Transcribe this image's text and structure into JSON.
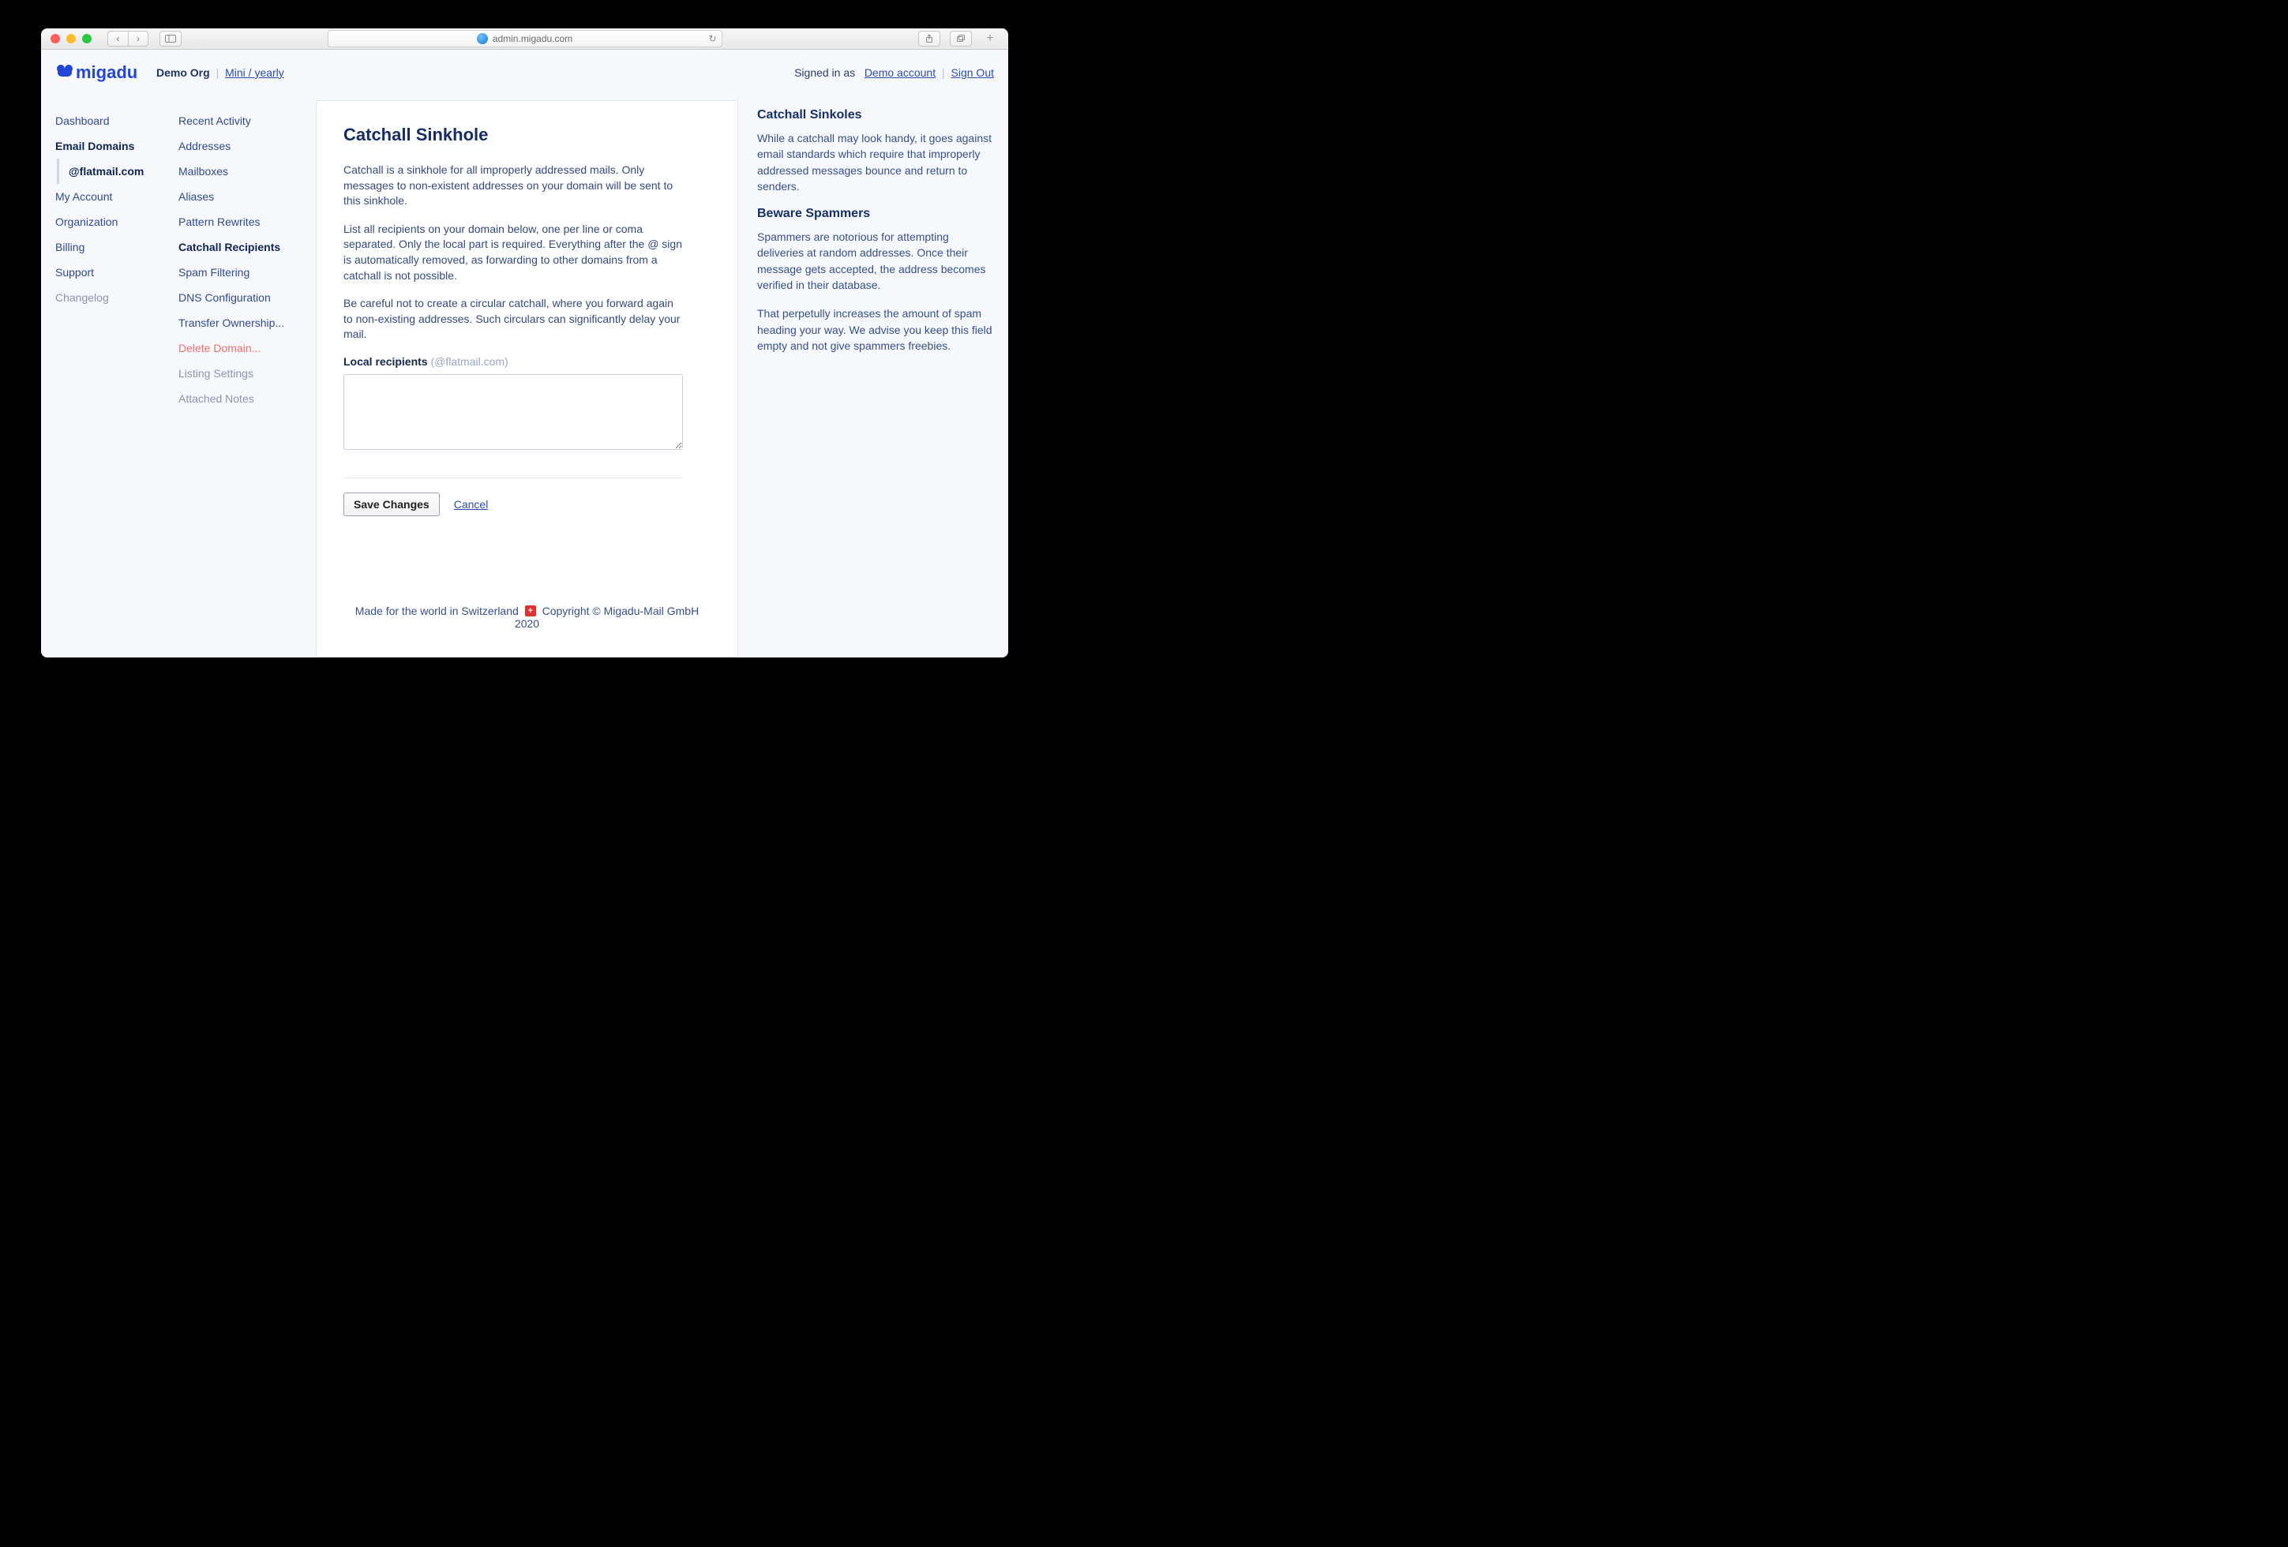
{
  "browser": {
    "url": "admin.migadu.com"
  },
  "header": {
    "logo_text": "migadu",
    "org_name": "Demo Org",
    "plan_link": "Mini / yearly",
    "signed_in_as": "Signed in as",
    "account_link": "Demo account",
    "sign_out": "Sign Out"
  },
  "sidebar1": {
    "dashboard": "Dashboard",
    "email_domains": "Email Domains",
    "flatmail": "@flatmail.com",
    "my_account": "My Account",
    "organization": "Organization",
    "billing": "Billing",
    "support": "Support",
    "changelog": "Changelog"
  },
  "sidebar2": {
    "recent_activity": "Recent Activity",
    "addresses": "Addresses",
    "mailboxes": "Mailboxes",
    "aliases": "Aliases",
    "pattern_rewrites": "Pattern Rewrites",
    "catchall_recipients": "Catchall Recipients",
    "spam_filtering": "Spam Filtering",
    "dns_configuration": "DNS Configuration",
    "transfer_ownership": "Transfer Ownership...",
    "delete_domain": "Delete Domain...",
    "listing_settings": "Listing Settings",
    "attached_notes": "Attached Notes"
  },
  "main": {
    "title": "Catchall Sinkhole",
    "p1": "Catchall is a sinkhole for all improperly addressed mails. Only messages to non-existent addresses on your domain will be sent to this sinkhole.",
    "p2": "List all recipients on your domain below, one per line or coma separated. Only the local part is required. Everything after the @ sign is automatically removed, as forwarding to other domains from a catchall is not possible.",
    "p3": "Be careful not to create a circular catchall, where you forward again to non-existing addresses. Such circulars can significantly delay your mail.",
    "field_label": "Local recipients",
    "field_hint": "(@flatmail.com)",
    "textarea_value": "",
    "save_label": "Save Changes",
    "cancel_label": "Cancel"
  },
  "footer": {
    "left": "Made for the world in Switzerland",
    "right": "Copyright © Migadu-Mail GmbH 2020"
  },
  "aside": {
    "h1": "Catchall Sinkoles",
    "p1": "While a catchall may look handy, it goes against email standards which require that improperly addressed messages bounce and return to senders.",
    "h2": "Beware Spammers",
    "p2": "Spammers are notorious for attempting deliveries at random addresses. Once their message gets accepted, the address becomes verified in their database.",
    "p3": "That perpetully increases the amount of spam heading your way. We advise you keep this field empty and not give spammers freebies."
  }
}
